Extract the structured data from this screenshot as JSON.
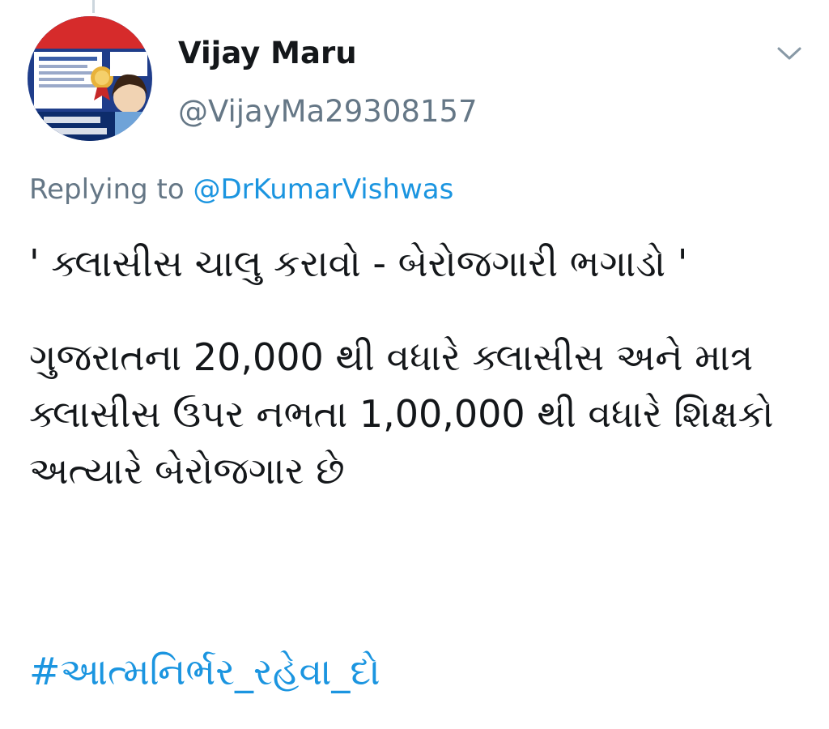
{
  "thread": {
    "connector": true
  },
  "avatar": {
    "alt": "Vijay Maru profile picture",
    "overlay_text": [
      "Admission",
      "ARIA",
      "INSTITUTE",
      "Std. 10 & 12",
      "2019-20",
      "Admissions Start",
      "Results Gaurantee",
      "ISANPUR"
    ]
  },
  "user": {
    "name": "Vijay Maru",
    "handle": "@VijayMa29308157"
  },
  "menu": {
    "icon": "chevron-down-icon"
  },
  "reply": {
    "prefix": "Replying to",
    "to": "@DrKumarVishwas"
  },
  "tweet": {
    "line1": "' ક્લાસીસ ચાલુ કરાવો - બેરોજગારી ભગાડો '",
    "paragraph2": "ગુજરાતના 20,000 થી વધારે ક્લાસીસ અને માત્ર ક્લાસીસ ઉપર નભતા 1,00,000 થી વધારે શિક્ષકો અત્યારે બેરોજગાર છે",
    "hashtag": "#આત્મનિર્ભર_રહેવા_દો"
  },
  "colors": {
    "text": "#14171a",
    "secondary": "#657786",
    "link": "#1b95e0"
  }
}
